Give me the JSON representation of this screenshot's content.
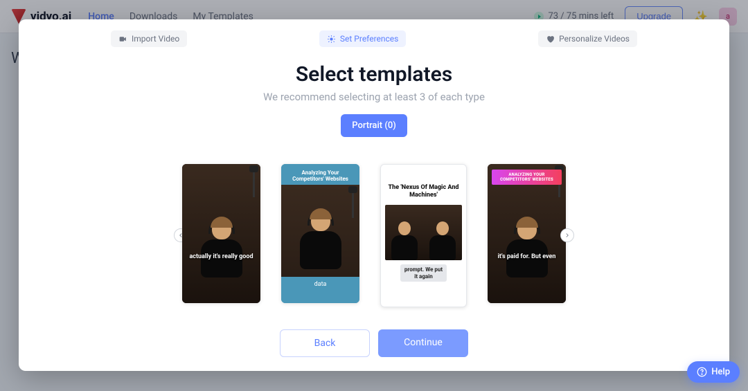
{
  "brand": "vidyo.ai",
  "nav": {
    "home": "Home",
    "downloads": "Downloads",
    "templates": "My Templates"
  },
  "mins_left": "73 / 75 mins left",
  "upgrade_label": "Upgrade",
  "avatar_initial": "a",
  "background_heading": "W",
  "stepper": {
    "import": "Import Video",
    "prefs": "Set Preferences",
    "personalize": "Personalize Videos"
  },
  "modal": {
    "title": "Select templates",
    "subtitle": "We recommend selecting at least 3 of each type",
    "pill": "Portrait (0)"
  },
  "templates": {
    "t1_caption": "actually it's really good",
    "t2_header": "Analyzing Your Competitors' Websites",
    "t2_footer": "data",
    "t3_title": "The 'Nexus Of Magic And Machines'",
    "t3_caption": "prompt. We put it again",
    "t4_banner": "ANALYZING YOUR COMPETITORS' WEBSITES",
    "t4_caption": "it's paid for. But even"
  },
  "buttons": {
    "back": "Back",
    "continue": "Continue"
  },
  "help_label": "Help"
}
